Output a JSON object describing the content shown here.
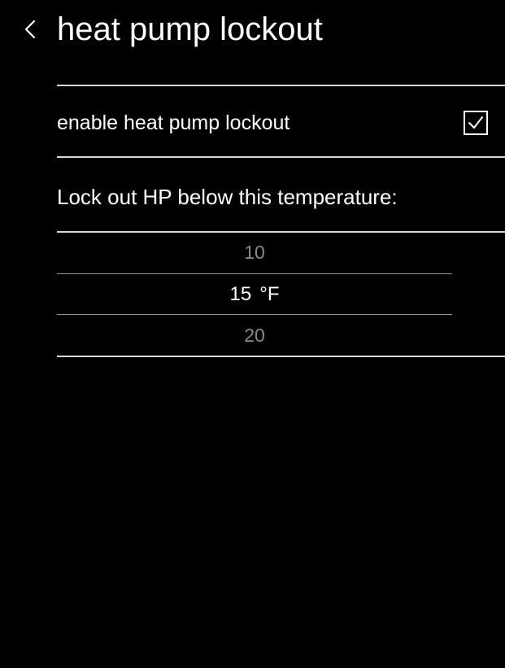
{
  "header": {
    "back_icon": "chevron-left-icon",
    "title": "heat pump lockout"
  },
  "lockout_toggle": {
    "label": "enable heat pump lockout",
    "checked": true,
    "icon": "checkmark-icon"
  },
  "temperature": {
    "label": "Lock out HP below this temperature:",
    "options": [
      "10",
      "15",
      "20"
    ],
    "selected_index": 1,
    "selected_value": "15",
    "unit": "°F"
  }
}
